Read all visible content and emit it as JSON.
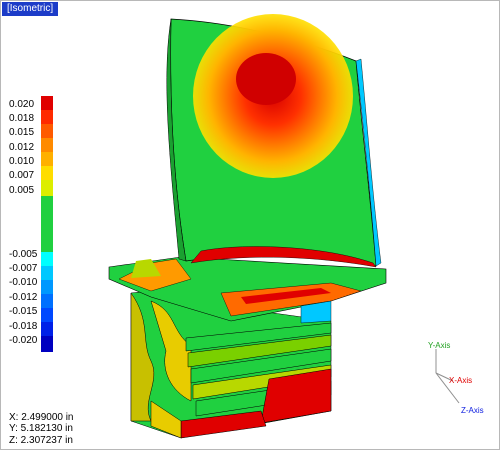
{
  "view": {
    "label": "[Isometric]"
  },
  "legend": {
    "ticks": [
      "0.020",
      "0.018",
      "0.015",
      "0.012",
      "0.010",
      "0.007",
      "0.005",
      "-0.005",
      "-0.007",
      "-0.010",
      "-0.012",
      "-0.015",
      "-0.018",
      "-0.020"
    ],
    "colors": [
      "#e00000",
      "#ff2a00",
      "#ff5a00",
      "#ff8a00",
      "#ffb000",
      "#ffdd00",
      "#dcee00",
      "#20d040",
      "#20d040",
      "#20d040",
      "#20d040",
      "#20d040",
      "#20d040",
      "#20d040",
      "#00ffff",
      "#00c8ff",
      "#0098ff",
      "#0070ff",
      "#0048ff",
      "#0020e8",
      "#0000c0"
    ]
  },
  "coords": {
    "x": "X: 2.499000 in",
    "y": "Y: 5.182130 in",
    "z": "Z: 2.307237 in"
  },
  "axes": {
    "y": "Y-Axis",
    "x": "X-Axis",
    "z": "Z-Axis"
  },
  "colors": {
    "title_bar": "#1c3cc8",
    "green": "#20d040",
    "red": "#e00000",
    "orange": "#ff8a00"
  }
}
